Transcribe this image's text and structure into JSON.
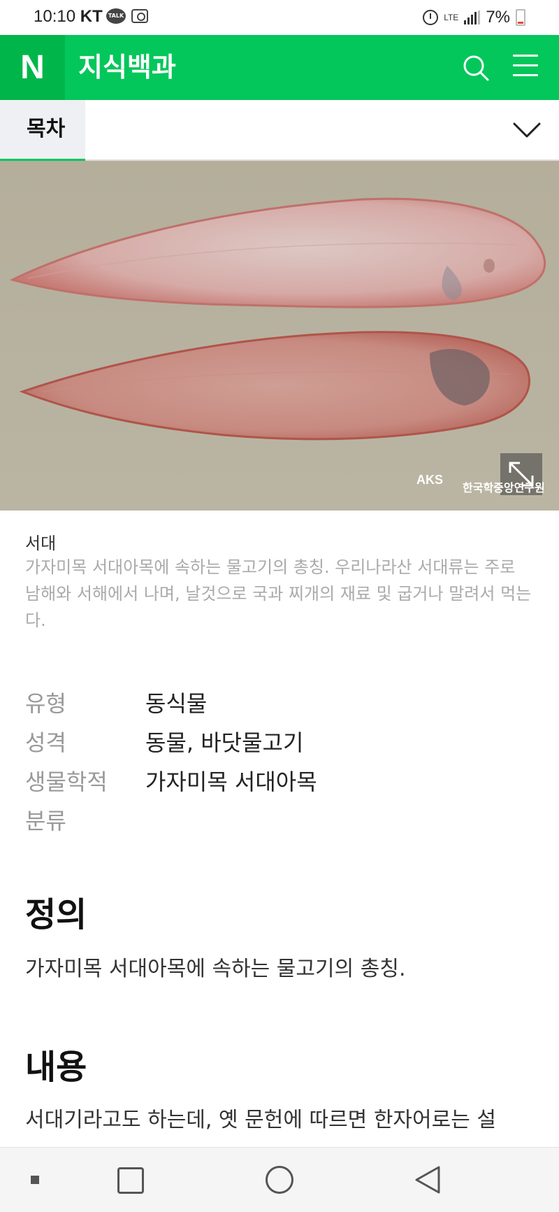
{
  "status_bar": {
    "time": "10:10",
    "carrier": "KT",
    "talk_badge": "TALK",
    "network": "LTE",
    "battery": "7%"
  },
  "header": {
    "logo": "N",
    "title": "지식백과"
  },
  "toc": {
    "label": "목차"
  },
  "image": {
    "credit_logo": "AKS",
    "credit_text": "한국학중앙연구원"
  },
  "caption": {
    "title": "서대",
    "description": "가자미목 서대아목에 속하는 물고기의 총칭. 우리나라산 서대류는 주로 남해와 서해에서 나며, 날것으로 국과 찌개의 재료 및 굽거나 말려서 먹는다."
  },
  "info": [
    {
      "key": "유형",
      "value": "동식물"
    },
    {
      "key": "성격",
      "value": "동물, 바닷물고기"
    },
    {
      "key": "생물학적",
      "value": "가자미목 서대아목"
    },
    {
      "key": "분류",
      "value": ""
    }
  ],
  "sections": {
    "definition_title": "정의",
    "definition_text": "가자미목 서대아목에 속하는 물고기의 총칭.",
    "content_title": "내용",
    "content_text": "서대기라고도 하는데, 옛 문헌에 따르면 한자어로는 설"
  },
  "colors": {
    "brand_green": "#03c75a"
  }
}
